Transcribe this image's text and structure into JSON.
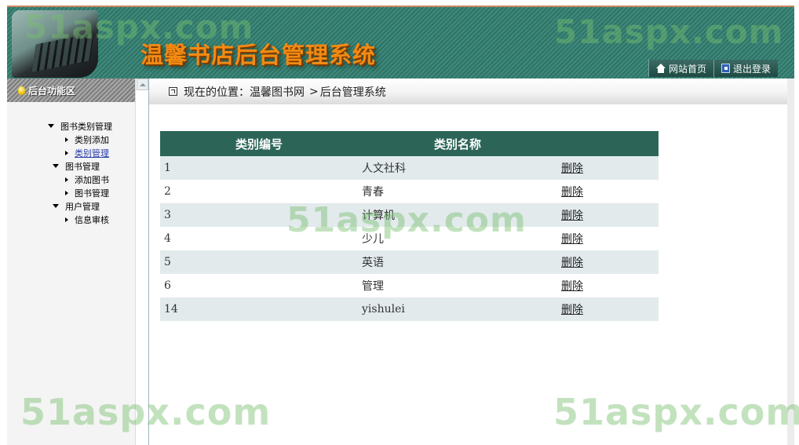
{
  "header": {
    "site_title": "温馨书店后台管理系统",
    "watermark": "51aspx.com",
    "links": [
      {
        "label": "网站首页",
        "icon": "home-icon"
      },
      {
        "label": "退出登录",
        "icon": "logout-icon"
      }
    ]
  },
  "sidebar": {
    "title": "后台功能区",
    "groups": [
      {
        "label": "图书类别管理",
        "items": [
          "类别添加",
          "类别管理"
        ]
      },
      {
        "label": "图书管理",
        "items": [
          "添加图书",
          "图书管理"
        ]
      },
      {
        "label": "用户管理",
        "items": [
          "信息审核"
        ]
      }
    ],
    "active_item": "类别管理"
  },
  "breadcrumb": {
    "prefix": "现在的位置：",
    "site": "温馨图书网",
    "separator": ">",
    "current": "后台管理系统"
  },
  "table": {
    "headers": [
      "类别编号",
      "类别名称",
      ""
    ],
    "rows": [
      {
        "id": "1",
        "name": "人文社科",
        "action": "删除"
      },
      {
        "id": "2",
        "name": "青春",
        "action": "删除"
      },
      {
        "id": "3",
        "name": "计算机",
        "action": "删除"
      },
      {
        "id": "4",
        "name": "少儿",
        "action": "删除"
      },
      {
        "id": "5",
        "name": "英语",
        "action": "删除"
      },
      {
        "id": "6",
        "name": "管理",
        "action": "删除"
      },
      {
        "id": "14",
        "name": "yishulei",
        "action": "删除"
      }
    ]
  },
  "colors": {
    "header_teal": "#2f7366",
    "table_header": "#2c6558",
    "row_stripe": "#e2eaec",
    "title_orange": "#f28a13"
  }
}
